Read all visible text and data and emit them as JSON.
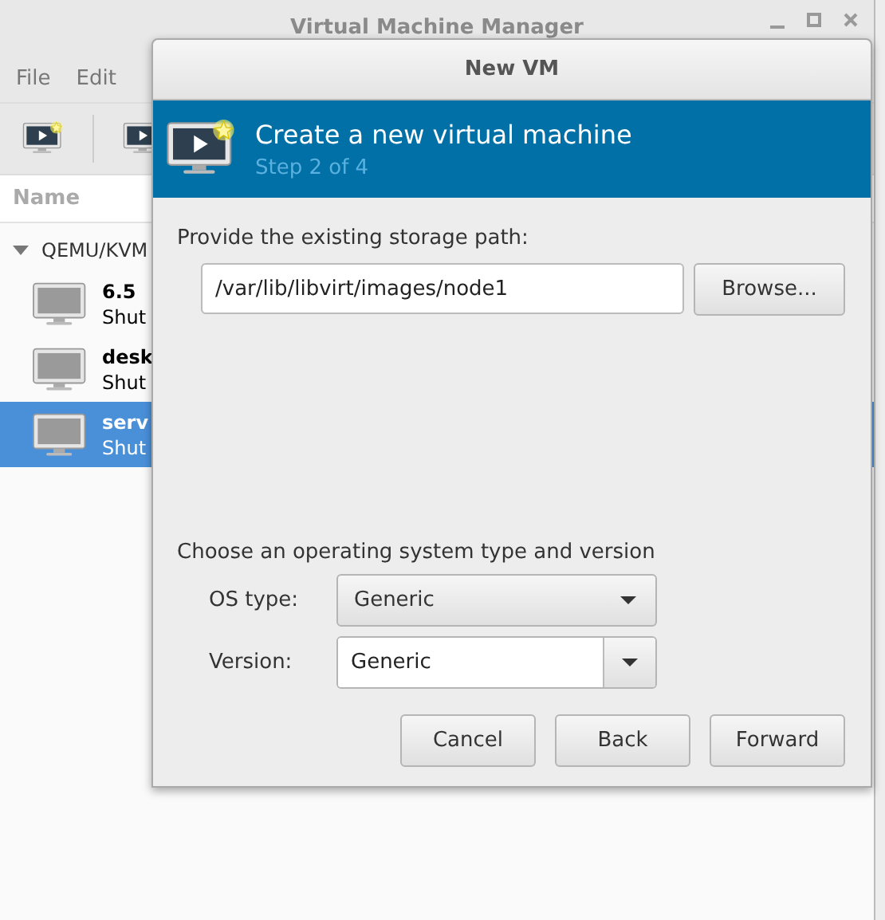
{
  "main_window": {
    "title": "Virtual Machine Manager",
    "menu": [
      "File",
      "Edit"
    ],
    "column_header": "Name",
    "tree": [
      {
        "label": "QEMU/KVM",
        "expanded": true,
        "children": [
          {
            "name": "6.5",
            "status": "Shut",
            "selected": false
          },
          {
            "name": "desk",
            "status": "Shut",
            "selected": false
          },
          {
            "name": "serv",
            "status": "Shut",
            "selected": true
          }
        ]
      }
    ]
  },
  "dialog": {
    "title": "New VM",
    "heading": "Create a new virtual machine",
    "step": "Step 2 of 4",
    "storage_label": "Provide the existing storage path:",
    "storage_path": "/var/lib/libvirt/images/node1",
    "browse_button": "Browse...",
    "os_label": "Choose an operating system type and version",
    "os_fields": [
      {
        "kind": "combo",
        "label": "OS type:",
        "value": "Generic"
      },
      {
        "kind": "entry",
        "label": "Version:",
        "value": "Generic"
      }
    ],
    "buttons": [
      "Cancel",
      "Back",
      "Forward"
    ]
  }
}
